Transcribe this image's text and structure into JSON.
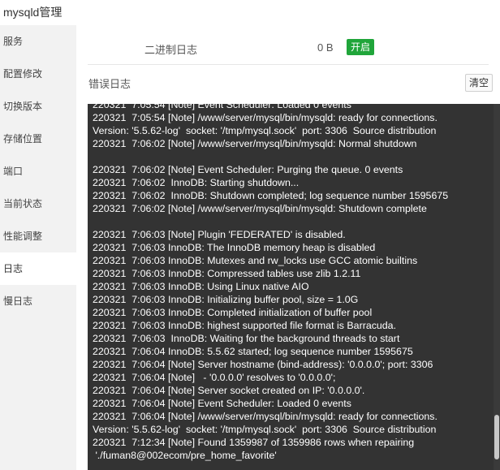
{
  "window": {
    "title": "mysqld管理"
  },
  "sidebar": {
    "items": [
      {
        "label": "服务"
      },
      {
        "label": "配置修改"
      },
      {
        "label": "切换版本"
      },
      {
        "label": "存储位置"
      },
      {
        "label": "端口"
      },
      {
        "label": "当前状态"
      },
      {
        "label": "性能调整"
      },
      {
        "label": "日志",
        "active": true
      },
      {
        "label": "慢日志"
      }
    ]
  },
  "binlog": {
    "label": "二进制日志",
    "size": "0 B",
    "enable_label": "开启"
  },
  "errorlog": {
    "label": "错误日志",
    "clear_label": "清空"
  },
  "log": {
    "lines": [
      "220321  7:05:54 [Note] Event Scheduler: Loaded 0 events",
      "220321  7:05:54 [Note] /www/server/mysql/bin/mysqld: ready for connections.",
      "Version: '5.5.62-log'  socket: '/tmp/mysql.sock'  port: 3306  Source distribution",
      "220321  7:06:02 [Note] /www/server/mysql/bin/mysqld: Normal shutdown",
      "",
      "220321  7:06:02 [Note] Event Scheduler: Purging the queue. 0 events",
      "220321  7:06:02  InnoDB: Starting shutdown...",
      "220321  7:06:02  InnoDB: Shutdown completed; log sequence number 1595675",
      "220321  7:06:02 [Note] /www/server/mysql/bin/mysqld: Shutdown complete",
      "",
      "220321  7:06:03 [Note] Plugin 'FEDERATED' is disabled.",
      "220321  7:06:03 InnoDB: The InnoDB memory heap is disabled",
      "220321  7:06:03 InnoDB: Mutexes and rw_locks use GCC atomic builtins",
      "220321  7:06:03 InnoDB: Compressed tables use zlib 1.2.11",
      "220321  7:06:03 InnoDB: Using Linux native AIO",
      "220321  7:06:03 InnoDB: Initializing buffer pool, size = 1.0G",
      "220321  7:06:03 InnoDB: Completed initialization of buffer pool",
      "220321  7:06:03 InnoDB: highest supported file format is Barracuda.",
      "220321  7:06:03  InnoDB: Waiting for the background threads to start",
      "220321  7:06:04 InnoDB: 5.5.62 started; log sequence number 1595675",
      "220321  7:06:04 [Note] Server hostname (bind-address): '0.0.0.0'; port: 3306",
      "220321  7:06:04 [Note]   - '0.0.0.0' resolves to '0.0.0.0';",
      "220321  7:06:04 [Note] Server socket created on IP: '0.0.0.0'.",
      "220321  7:06:04 [Note] Event Scheduler: Loaded 0 events",
      "220321  7:06:04 [Note] /www/server/mysql/bin/mysqld: ready for connections.",
      "Version: '5.5.62-log'  socket: '/tmp/mysql.sock'  port: 3306  Source distribution",
      "220321  7:12:34 [Note] Found 1359987 of 1359986 rows when repairing",
      " './fuman8@002ecom/pre_home_favorite'"
    ]
  }
}
